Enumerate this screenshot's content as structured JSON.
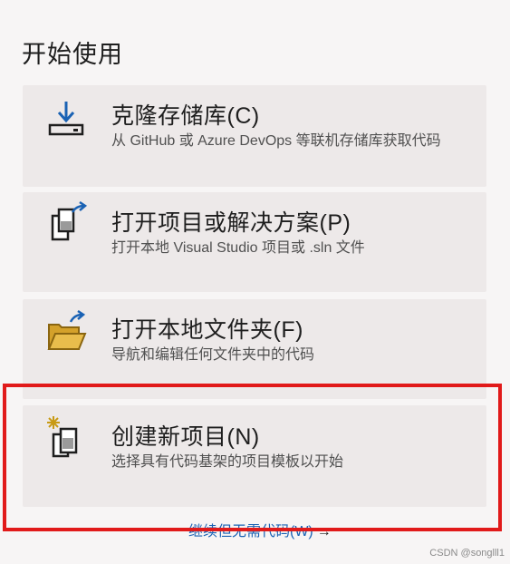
{
  "start": {
    "heading": "开始使用",
    "cards": [
      {
        "title": "克隆存储库(C)",
        "description": "从 GitHub 或 Azure DevOps 等联机存储库获取代码",
        "icon": "clone-download-icon"
      },
      {
        "title": "打开项目或解决方案(P)",
        "description": "打开本地 Visual Studio 项目或 .sln 文件",
        "icon": "open-project-icon"
      },
      {
        "title": "打开本地文件夹(F)",
        "description": "导航和编辑任何文件夹中的代码",
        "icon": "open-folder-icon"
      },
      {
        "title": "创建新项目(N)",
        "description": "选择具有代码基架的项目模板以开始",
        "icon": "new-project-icon"
      }
    ],
    "continue_link": "继续但无需代码(W)",
    "continue_arrow": "→"
  },
  "annotation": {
    "highlight_color": "#e11a1a"
  },
  "colors": {
    "accent": "#1a62b4",
    "folder": "#d4a12a",
    "sparkle": "#c89a14"
  },
  "watermark": "CSDN @songlll1"
}
